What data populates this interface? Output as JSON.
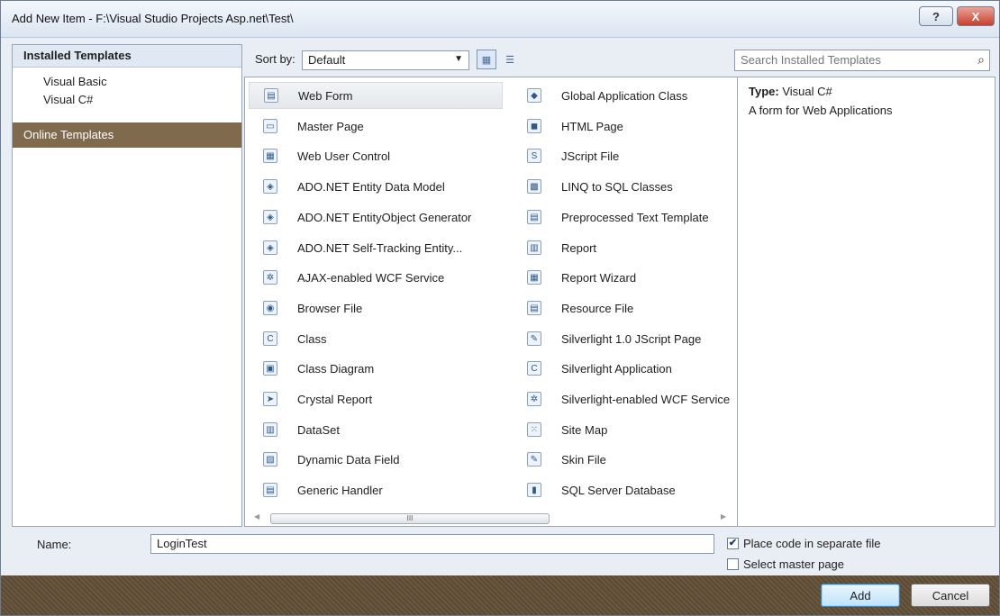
{
  "window": {
    "title": "Add New Item - F:\\Visual Studio Projects Asp.net\\Test\\"
  },
  "sidebar": {
    "header": "Installed Templates",
    "items": [
      {
        "label": "Visual Basic"
      },
      {
        "label": "Visual C#"
      }
    ],
    "online": "Online Templates"
  },
  "toolbar": {
    "sort_label": "Sort by:",
    "sort_value": "Default"
  },
  "search": {
    "placeholder": "Search Installed Templates"
  },
  "templates": {
    "col1": [
      {
        "label": "Web Form",
        "icon": "web-form-icon",
        "selected": true
      },
      {
        "label": "Master Page",
        "icon": "master-page-icon"
      },
      {
        "label": "Web User Control",
        "icon": "web-user-control-icon"
      },
      {
        "label": "ADO.NET Entity Data Model",
        "icon": "entity-data-model-icon"
      },
      {
        "label": "ADO.NET EntityObject Generator",
        "icon": "entity-generator-icon"
      },
      {
        "label": "ADO.NET Self-Tracking Entity...",
        "icon": "self-tracking-entity-icon"
      },
      {
        "label": "AJAX-enabled WCF Service",
        "icon": "wcf-service-icon"
      },
      {
        "label": "Browser File",
        "icon": "browser-file-icon"
      },
      {
        "label": "Class",
        "icon": "class-icon"
      },
      {
        "label": "Class Diagram",
        "icon": "class-diagram-icon"
      },
      {
        "label": "Crystal Report",
        "icon": "crystal-report-icon"
      },
      {
        "label": "DataSet",
        "icon": "dataset-icon"
      },
      {
        "label": "Dynamic Data Field",
        "icon": "dynamic-data-field-icon"
      },
      {
        "label": "Generic Handler",
        "icon": "generic-handler-icon"
      }
    ],
    "col2": [
      {
        "label": "Global Application Class",
        "icon": "global-application-class-icon"
      },
      {
        "label": "HTML Page",
        "icon": "html-page-icon"
      },
      {
        "label": "JScript File",
        "icon": "jscript-file-icon"
      },
      {
        "label": "LINQ to SQL Classes",
        "icon": "linq-to-sql-icon"
      },
      {
        "label": "Preprocessed Text Template",
        "icon": "text-template-icon"
      },
      {
        "label": "Report",
        "icon": "report-icon"
      },
      {
        "label": "Report Wizard",
        "icon": "report-wizard-icon"
      },
      {
        "label": "Resource File",
        "icon": "resource-file-icon"
      },
      {
        "label": "Silverlight 1.0 JScript Page",
        "icon": "silverlight-jscript-icon"
      },
      {
        "label": "Silverlight Application",
        "icon": "silverlight-application-icon"
      },
      {
        "label": "Silverlight-enabled WCF Service",
        "icon": "silverlight-wcf-icon"
      },
      {
        "label": "Site Map",
        "icon": "site-map-icon"
      },
      {
        "label": "Skin File",
        "icon": "skin-file-icon"
      },
      {
        "label": "SQL Server Database",
        "icon": "sql-database-icon"
      }
    ]
  },
  "scrollbar": {
    "thumb_label": "III"
  },
  "details": {
    "type_label": "Type:",
    "type_value": "Visual C#",
    "description": "A form for Web Applications"
  },
  "form": {
    "name_label": "Name:",
    "name_value": "LoginTest"
  },
  "options": {
    "code_separate": {
      "label": "Place code in separate file",
      "checked": true
    },
    "master_page": {
      "label": "Select master page",
      "checked": false
    }
  },
  "buttons": {
    "add": "Add",
    "cancel": "Cancel",
    "help": "?",
    "close": "X"
  }
}
